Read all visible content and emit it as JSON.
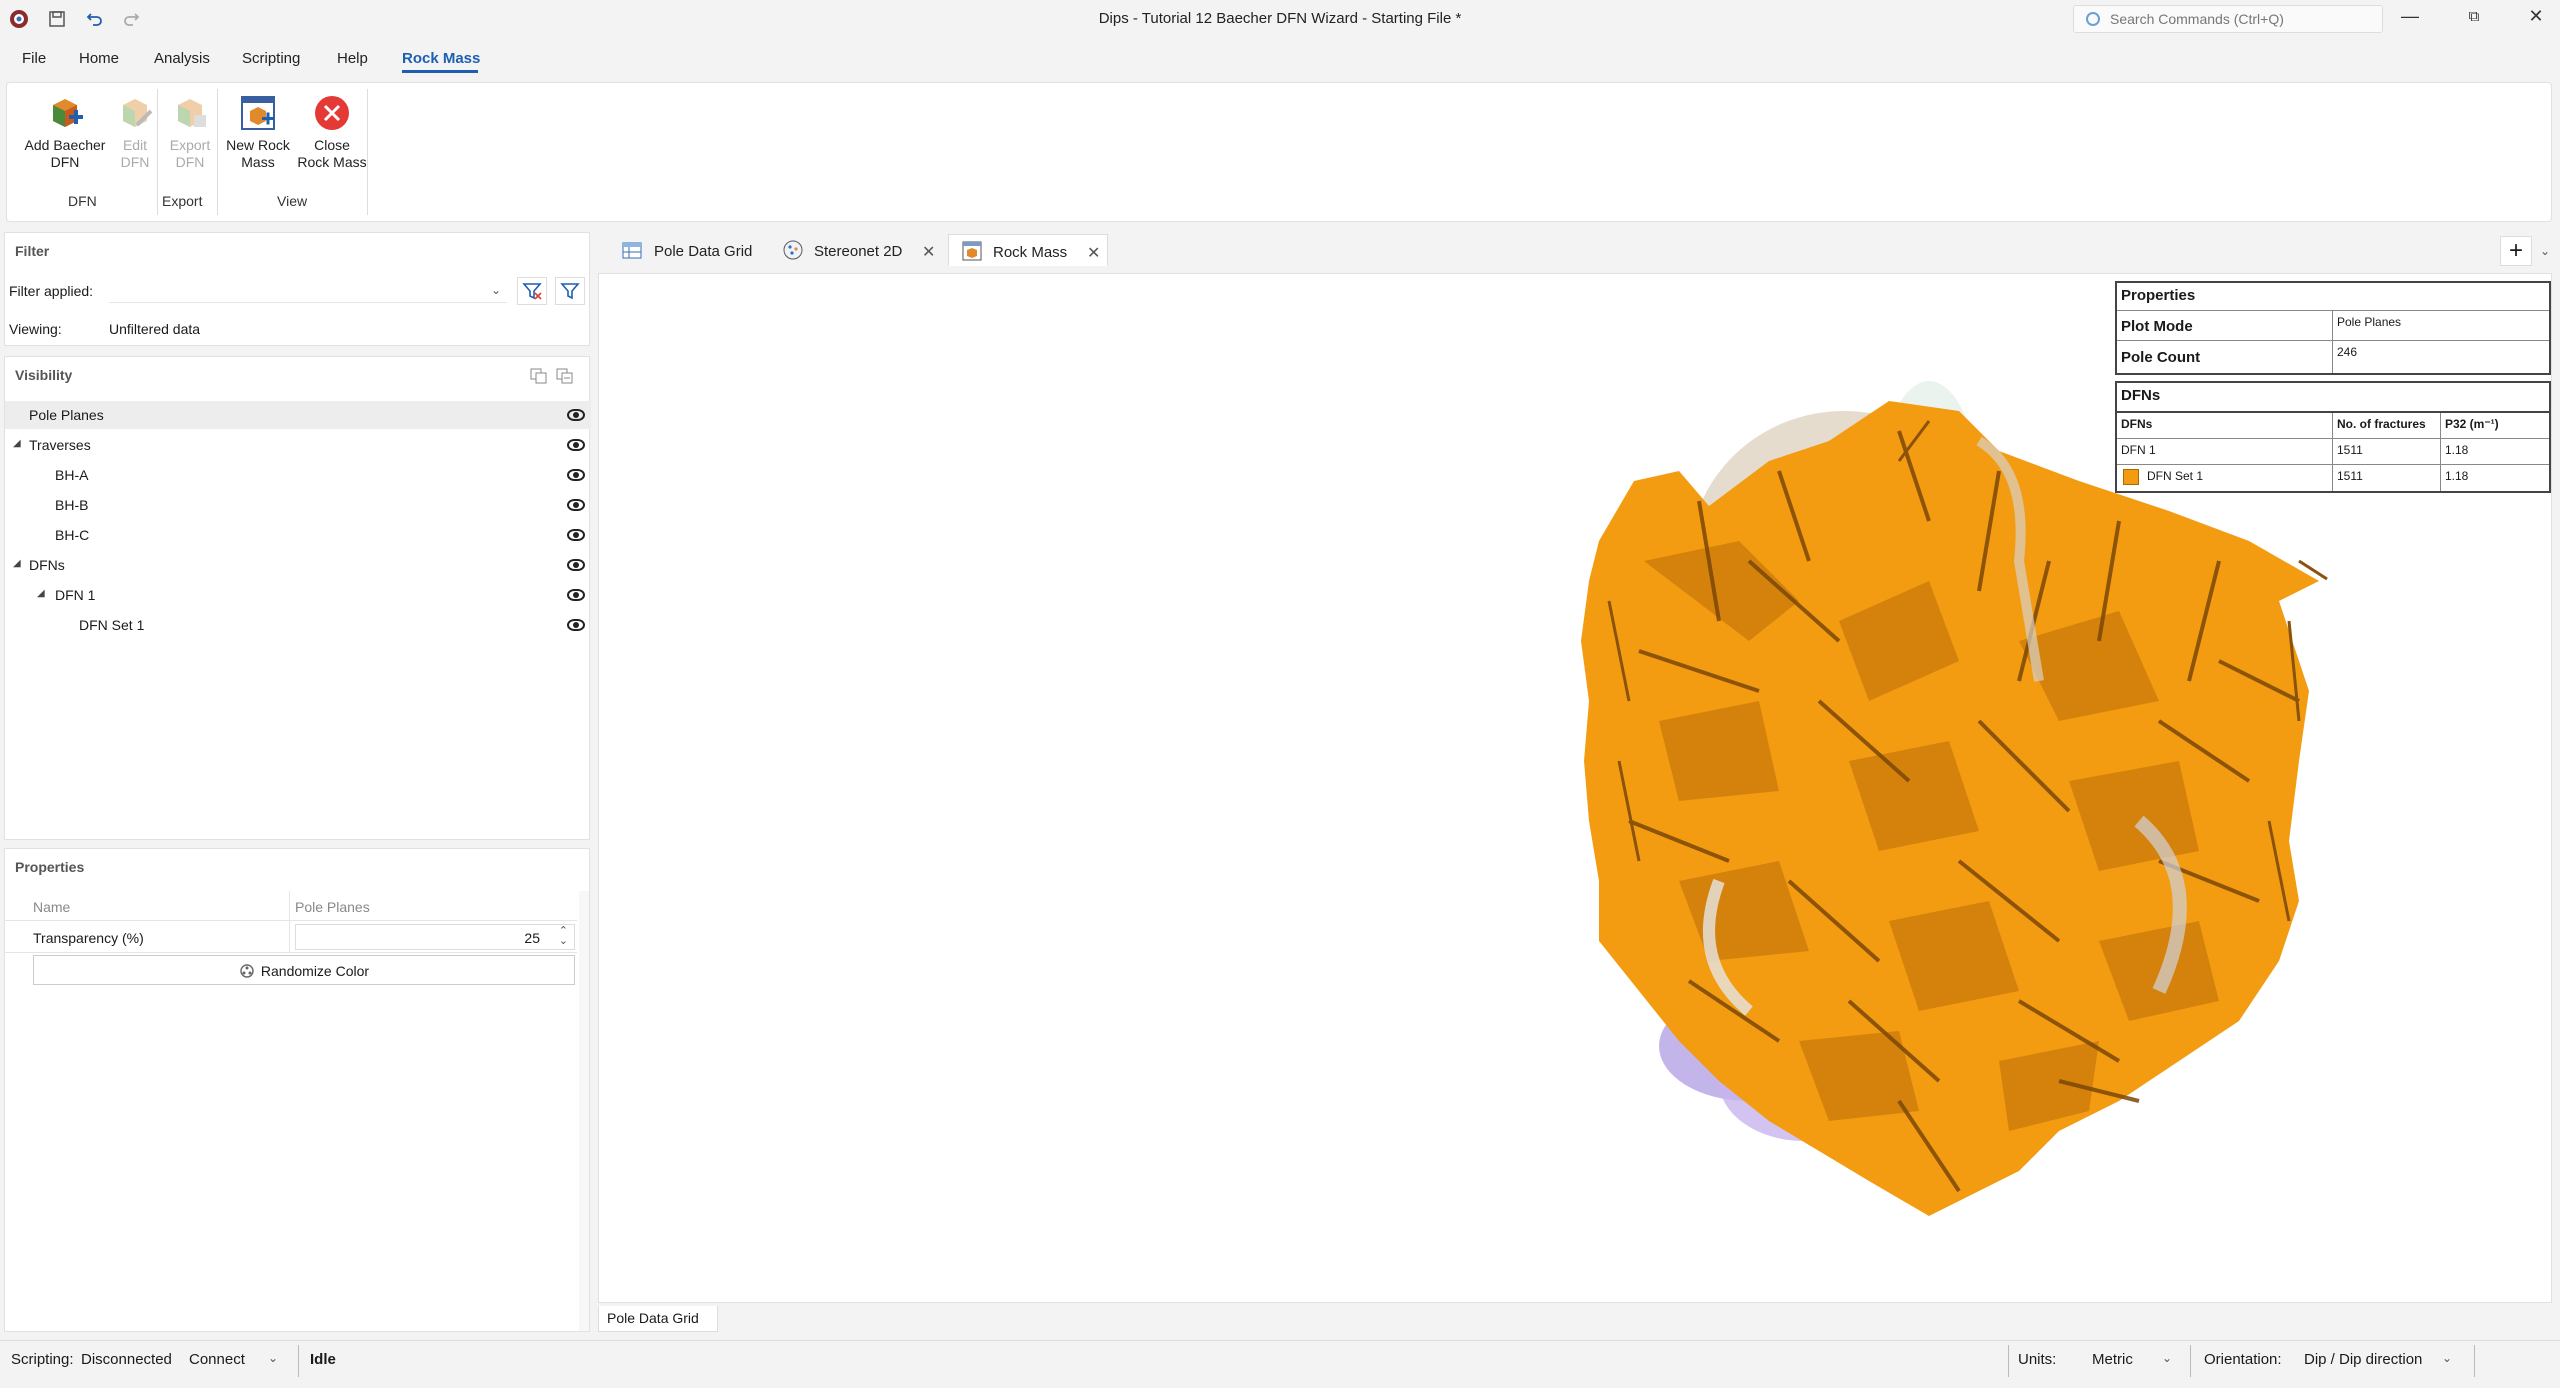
{
  "window": {
    "title": "Dips - Tutorial 12 Baecher DFN Wizard - Starting File *",
    "search_placeholder": "Search Commands (Ctrl+Q)"
  },
  "menu": {
    "items": [
      "File",
      "Home",
      "Analysis",
      "Scripting",
      "Help",
      "Rock Mass"
    ],
    "active": "Rock Mass"
  },
  "ribbon": {
    "buttons": [
      {
        "label1": "Add Baecher",
        "label2": "DFN",
        "enabled": true,
        "icon": "add-dfn-icon"
      },
      {
        "label1": "Edit",
        "label2": "DFN",
        "enabled": false,
        "icon": "edit-dfn-icon"
      },
      {
        "label1": "Export",
        "label2": "DFN",
        "enabled": false,
        "icon": "export-dfn-icon"
      },
      {
        "label1": "New Rock",
        "label2": "Mass",
        "enabled": true,
        "icon": "new-rock-mass-icon"
      },
      {
        "label1": "Close",
        "label2": "Rock Mass",
        "enabled": true,
        "icon": "close-circle-icon"
      }
    ],
    "groups": [
      "DFN",
      "Export",
      "View"
    ]
  },
  "filter": {
    "header": "Filter",
    "applied_label": "Filter applied:",
    "viewing_label": "Viewing:",
    "viewing_value": "Unfiltered data"
  },
  "visibility": {
    "header": "Visibility",
    "items": [
      {
        "label": "Pole Planes",
        "selected": true
      },
      {
        "label": "Traverses"
      },
      {
        "label": "BH-A"
      },
      {
        "label": "BH-B"
      },
      {
        "label": "BH-C"
      },
      {
        "label": "DFNs"
      },
      {
        "label": "DFN 1"
      },
      {
        "label": "DFN Set 1"
      }
    ]
  },
  "properties_panel": {
    "header": "Properties",
    "col_name": "Name",
    "col_value": "Pole Planes",
    "rows": [
      {
        "name": "Transparency (%)",
        "value": "25"
      }
    ],
    "randomize_label": "Randomize Color"
  },
  "tabs": [
    {
      "label": "Pole Data Grid",
      "icon": "grid-icon",
      "active": false
    },
    {
      "label": "Stereonet 2D",
      "icon": "stereonet-icon",
      "active": false
    },
    {
      "label": "Rock Mass",
      "icon": "rock-mass-icon",
      "active": true
    }
  ],
  "viewport": {
    "bottom_tab": "Pole Data Grid",
    "props_title": "Properties",
    "plot_mode_label": "Plot Mode",
    "plot_mode_value": "Pole Planes",
    "pole_count_label": "Pole Count",
    "pole_count_value": "246",
    "dfns_title": "DFNs",
    "dfn_headers": [
      "DFNs",
      "No. of fractures",
      "P32 (m⁻¹)"
    ],
    "dfn_rows": [
      {
        "name": "DFN 1",
        "fractures": "1511",
        "p32": "1.18"
      },
      {
        "name": "DFN Set 1",
        "fractures": "1511",
        "p32": "1.18",
        "swatch": "#f39c12"
      }
    ],
    "fracture_color": "#f39c12"
  },
  "statusbar": {
    "scripting_label": "Scripting:",
    "scripting_value": "Disconnected",
    "connect_label": "Connect",
    "state": "Idle",
    "units_label": "Units:",
    "units_value": "Metric",
    "orientation_label": "Orientation:",
    "orientation_value": "Dip / Dip direction"
  }
}
